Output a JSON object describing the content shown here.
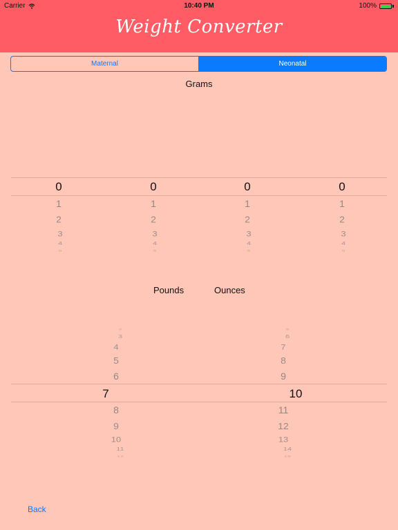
{
  "status": {
    "carrier": "Carrier",
    "time": "10:40 PM",
    "battery": "100%"
  },
  "header": {
    "title": "Weight Converter"
  },
  "segment": {
    "maternal": "Maternal",
    "neonatal": "Neonatal",
    "selected": "Neonatal"
  },
  "grams": {
    "label": "Grams",
    "columns": [
      {
        "selected": "0",
        "below": [
          "1",
          "2",
          "3",
          "4",
          "5"
        ]
      },
      {
        "selected": "0",
        "below": [
          "1",
          "2",
          "3",
          "4",
          "5"
        ]
      },
      {
        "selected": "0",
        "below": [
          "1",
          "2",
          "3",
          "4",
          "5"
        ]
      },
      {
        "selected": "0",
        "below": [
          "1",
          "2",
          "3",
          "4",
          "5"
        ]
      }
    ]
  },
  "pounds": {
    "label": "Pounds",
    "selected": "7",
    "above": [
      "2",
      "3",
      "4",
      "5",
      "6"
    ],
    "below": [
      "8",
      "9",
      "10",
      "11",
      "12"
    ]
  },
  "ounces": {
    "label": "Ounces",
    "selected": "10",
    "above": [
      "5",
      "6",
      "7",
      "8",
      "9"
    ],
    "below": [
      "11",
      "12",
      "13",
      "14",
      "15"
    ]
  },
  "nav": {
    "back": "Back"
  },
  "colors": {
    "background": "#ffc7b8",
    "header": "#ff5c65",
    "accent": "#0a7aff"
  }
}
